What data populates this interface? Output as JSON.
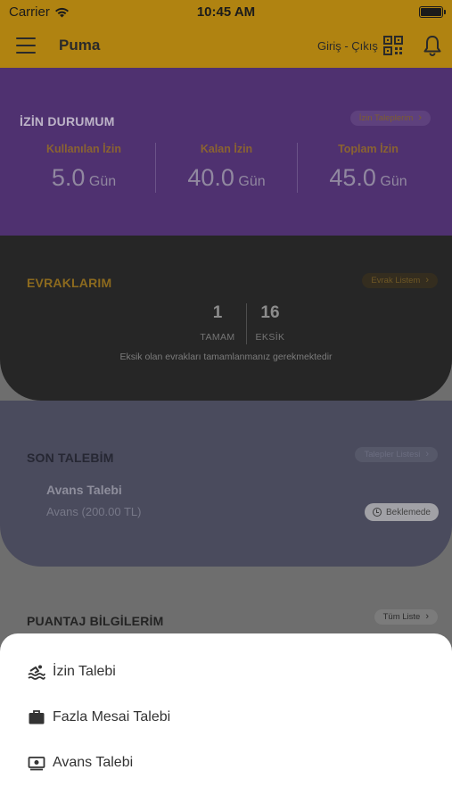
{
  "status_bar": {
    "carrier": "Carrier",
    "time": "10:45 AM"
  },
  "navbar": {
    "title": "Puma",
    "check_in_out": "Giriş - Çıkış",
    "menu_icon": "hamburger-menu-icon",
    "qr_icon": "qr-code-icon",
    "bell_icon": "bell-icon"
  },
  "leave_status": {
    "title": "İZİN DURUMUM",
    "link": "İzin Taleplerim",
    "stats": [
      {
        "label": "Kullanılan İzin",
        "value": "5.0",
        "unit": "Gün"
      },
      {
        "label": "Kalan İzin",
        "value": "40.0",
        "unit": "Gün"
      },
      {
        "label": "Toplam İzin",
        "value": "45.0",
        "unit": "Gün"
      }
    ]
  },
  "documents": {
    "title": "EVRAKLARIM",
    "link": "Evrak Listem",
    "complete_count": "1",
    "complete_label": "TAMAM",
    "missing_count": "16",
    "missing_label": "EKSİK",
    "note": "Eksik olan evrakları tamamlanmanız gerekmektedir"
  },
  "last_request": {
    "title": "SON TALEBİM",
    "link": "Talepler Listesi",
    "name": "Avans Talebi",
    "detail": "Avans (200.00 TL)",
    "status": "Beklemede"
  },
  "timesheet": {
    "title": "PUANTAJ BİLGİLERİM",
    "link": "Tüm Liste"
  },
  "sheet": {
    "items": [
      {
        "label": "İzin Talebi",
        "icon": "swim-icon"
      },
      {
        "label": "Fazla Mesai Talebi",
        "icon": "briefcase-icon"
      },
      {
        "label": "Avans Talebi",
        "icon": "cash-icon"
      }
    ]
  },
  "colors": {
    "header": "#b08311",
    "leave_card": "#4f3170",
    "docs_card": "#262626",
    "request_card": "#4a4b5d",
    "sheet": "#ffffff"
  }
}
